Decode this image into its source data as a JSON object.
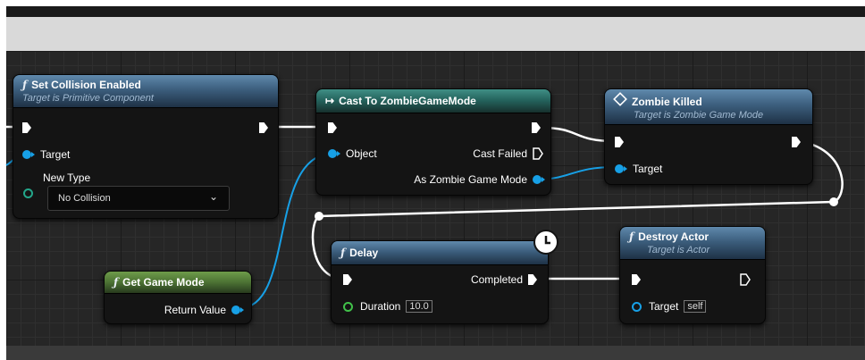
{
  "nodes": {
    "set_collision": {
      "title": "Set Collision Enabled",
      "subtitle": "Target is Primitive Component",
      "target_label": "Target",
      "new_type_label": "New Type",
      "new_type_value": "No Collision"
    },
    "cast": {
      "title": "Cast To ZombieGameMode",
      "object_label": "Object",
      "cast_failed_label": "Cast Failed",
      "as_label": "As Zombie Game Mode"
    },
    "zombie_killed": {
      "title": "Zombie Killed",
      "subtitle": "Target is Zombie Game Mode",
      "target_label": "Target"
    },
    "get_game_mode": {
      "title": "Get Game Mode",
      "return_label": "Return Value"
    },
    "delay": {
      "title": "Delay",
      "completed_label": "Completed",
      "duration_label": "Duration",
      "duration_value": "10.0"
    },
    "destroy_actor": {
      "title": "Destroy Actor",
      "subtitle": "Target is Actor",
      "target_label": "Target",
      "target_value": "self"
    }
  },
  "icons": {
    "function": "ƒ",
    "cast": "↦",
    "event": "diamond-icon",
    "latent": "clock-icon"
  },
  "colors": {
    "object_pin": "#17a0e6",
    "exec_wire": "#ffffff",
    "function_header": "#3c5e7d",
    "cast_header": "#23605a",
    "pure_header": "#4c7234"
  }
}
